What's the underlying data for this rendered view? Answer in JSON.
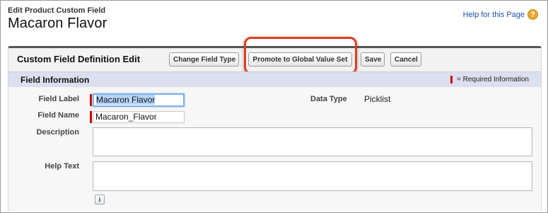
{
  "header": {
    "breadcrumb": "Edit Product Custom Field",
    "title": "Macaron Flavor",
    "help_link": "Help for this Page",
    "help_icon": "question-icon"
  },
  "panel": {
    "title": "Custom Field Definition Edit",
    "buttons": {
      "change_field_type": "Change Field Type",
      "promote": "Promote to Global Value Set",
      "save": "Save",
      "cancel": "Cancel"
    }
  },
  "section": {
    "title": "Field Information",
    "required_legend": "= Required Information"
  },
  "form": {
    "field_label": {
      "label": "Field Label",
      "value": "Macaron Flavor"
    },
    "field_name": {
      "label": "Field Name",
      "value": "Macaron_Flavor"
    },
    "description": {
      "label": "Description",
      "value": ""
    },
    "help_text": {
      "label": "Help Text",
      "value": ""
    },
    "data_type": {
      "label": "Data Type",
      "value": "Picklist"
    },
    "info_button": "i"
  },
  "colors": {
    "required": "#cc0000",
    "highlight": "#e33b25",
    "section_bar": "#dcdff0",
    "link": "#1f4fa8"
  }
}
